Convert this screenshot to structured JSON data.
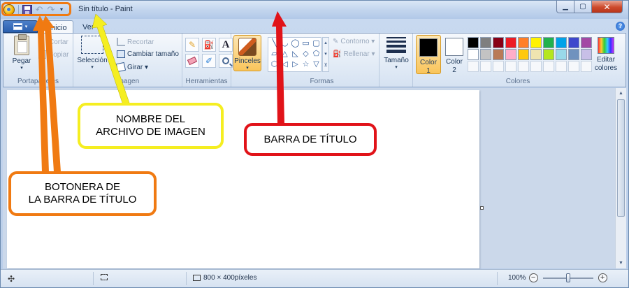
{
  "window": {
    "title": "Sin título - Paint",
    "controls": {
      "minimize": "▁",
      "maximize": "▢",
      "close": "✕"
    }
  },
  "qat": {
    "undo": "↶",
    "redo": "↷",
    "dropdown": "▾"
  },
  "tabs": {
    "menu_arrow": "▾",
    "items": [
      {
        "label": "Inicio"
      },
      {
        "label": "Ver"
      }
    ],
    "help": "?"
  },
  "ribbon": {
    "portapapeles": {
      "label": "Portapapeles",
      "paste": "Pegar",
      "paste_arrow": "▾",
      "cut": "Cortar",
      "copy": "Copiar"
    },
    "imagen": {
      "label": "Imagen",
      "select": "Selección",
      "select_arrow": "▾",
      "crop": "Recortar",
      "resize": "Cambiar tamaño",
      "rotate": "Girar ▾"
    },
    "herramientas": {
      "label": "Herramientas",
      "pencil": "✎",
      "fill": "⛽",
      "text": "A",
      "picker": "✐"
    },
    "pinceles": {
      "label": "Pinceles",
      "arrow": "▾"
    },
    "formas": {
      "label": "Formas",
      "shapes": [
        "╲",
        "◡",
        "◯",
        "▭",
        "▢",
        "▱",
        "△",
        "◺",
        "◇",
        "⬠",
        "⬡",
        "◁",
        "▷",
        "☆",
        "▽"
      ],
      "outline": "Contorno ▾",
      "fill": "Rellenar ▾",
      "scroll": [
        "▴",
        "▾",
        "⊻"
      ]
    },
    "tamano": {
      "label": "Tamaño",
      "arrow": "▾"
    },
    "colores": {
      "label": "Colores",
      "color1_label": "Color",
      "color1_num": "1",
      "color2_label": "Color",
      "color2_num": "2",
      "color1": "#000000",
      "color2": "#ffffff",
      "palette": [
        "#000000",
        "#7f7f7f",
        "#880015",
        "#ed1c24",
        "#ff7f27",
        "#fff200",
        "#22b14c",
        "#00a2e8",
        "#3f48cc",
        "#a349a4",
        "#ffffff",
        "#c3c3c3",
        "#b97a57",
        "#ffaec9",
        "#ffc90e",
        "#efe4b0",
        "#b5e61d",
        "#99d9ea",
        "#7092be",
        "#c8bfe7"
      ],
      "edit_line1": "Editar",
      "edit_line2": "colores"
    }
  },
  "statusbar": {
    "move": "✣",
    "dimensions": "800 × 400píxeles",
    "zoom": "100%",
    "zoom_out": "−",
    "zoom_in": "+"
  },
  "scrollbar": {
    "up": "▲",
    "down": "▼"
  },
  "annotations": {
    "titlebar_buttons_line1": "BOTONERA DE",
    "titlebar_buttons_line2": "LA BARRA DE TÍTULO",
    "filename_line1": "NOMBRE DEL",
    "filename_line2": "ARCHIVO DE IMAGEN",
    "titlebar": "BARRA DE TÍTULO",
    "colors": {
      "orange": "#f07a12",
      "yellow": "#f5ee21",
      "red": "#e11319"
    }
  }
}
